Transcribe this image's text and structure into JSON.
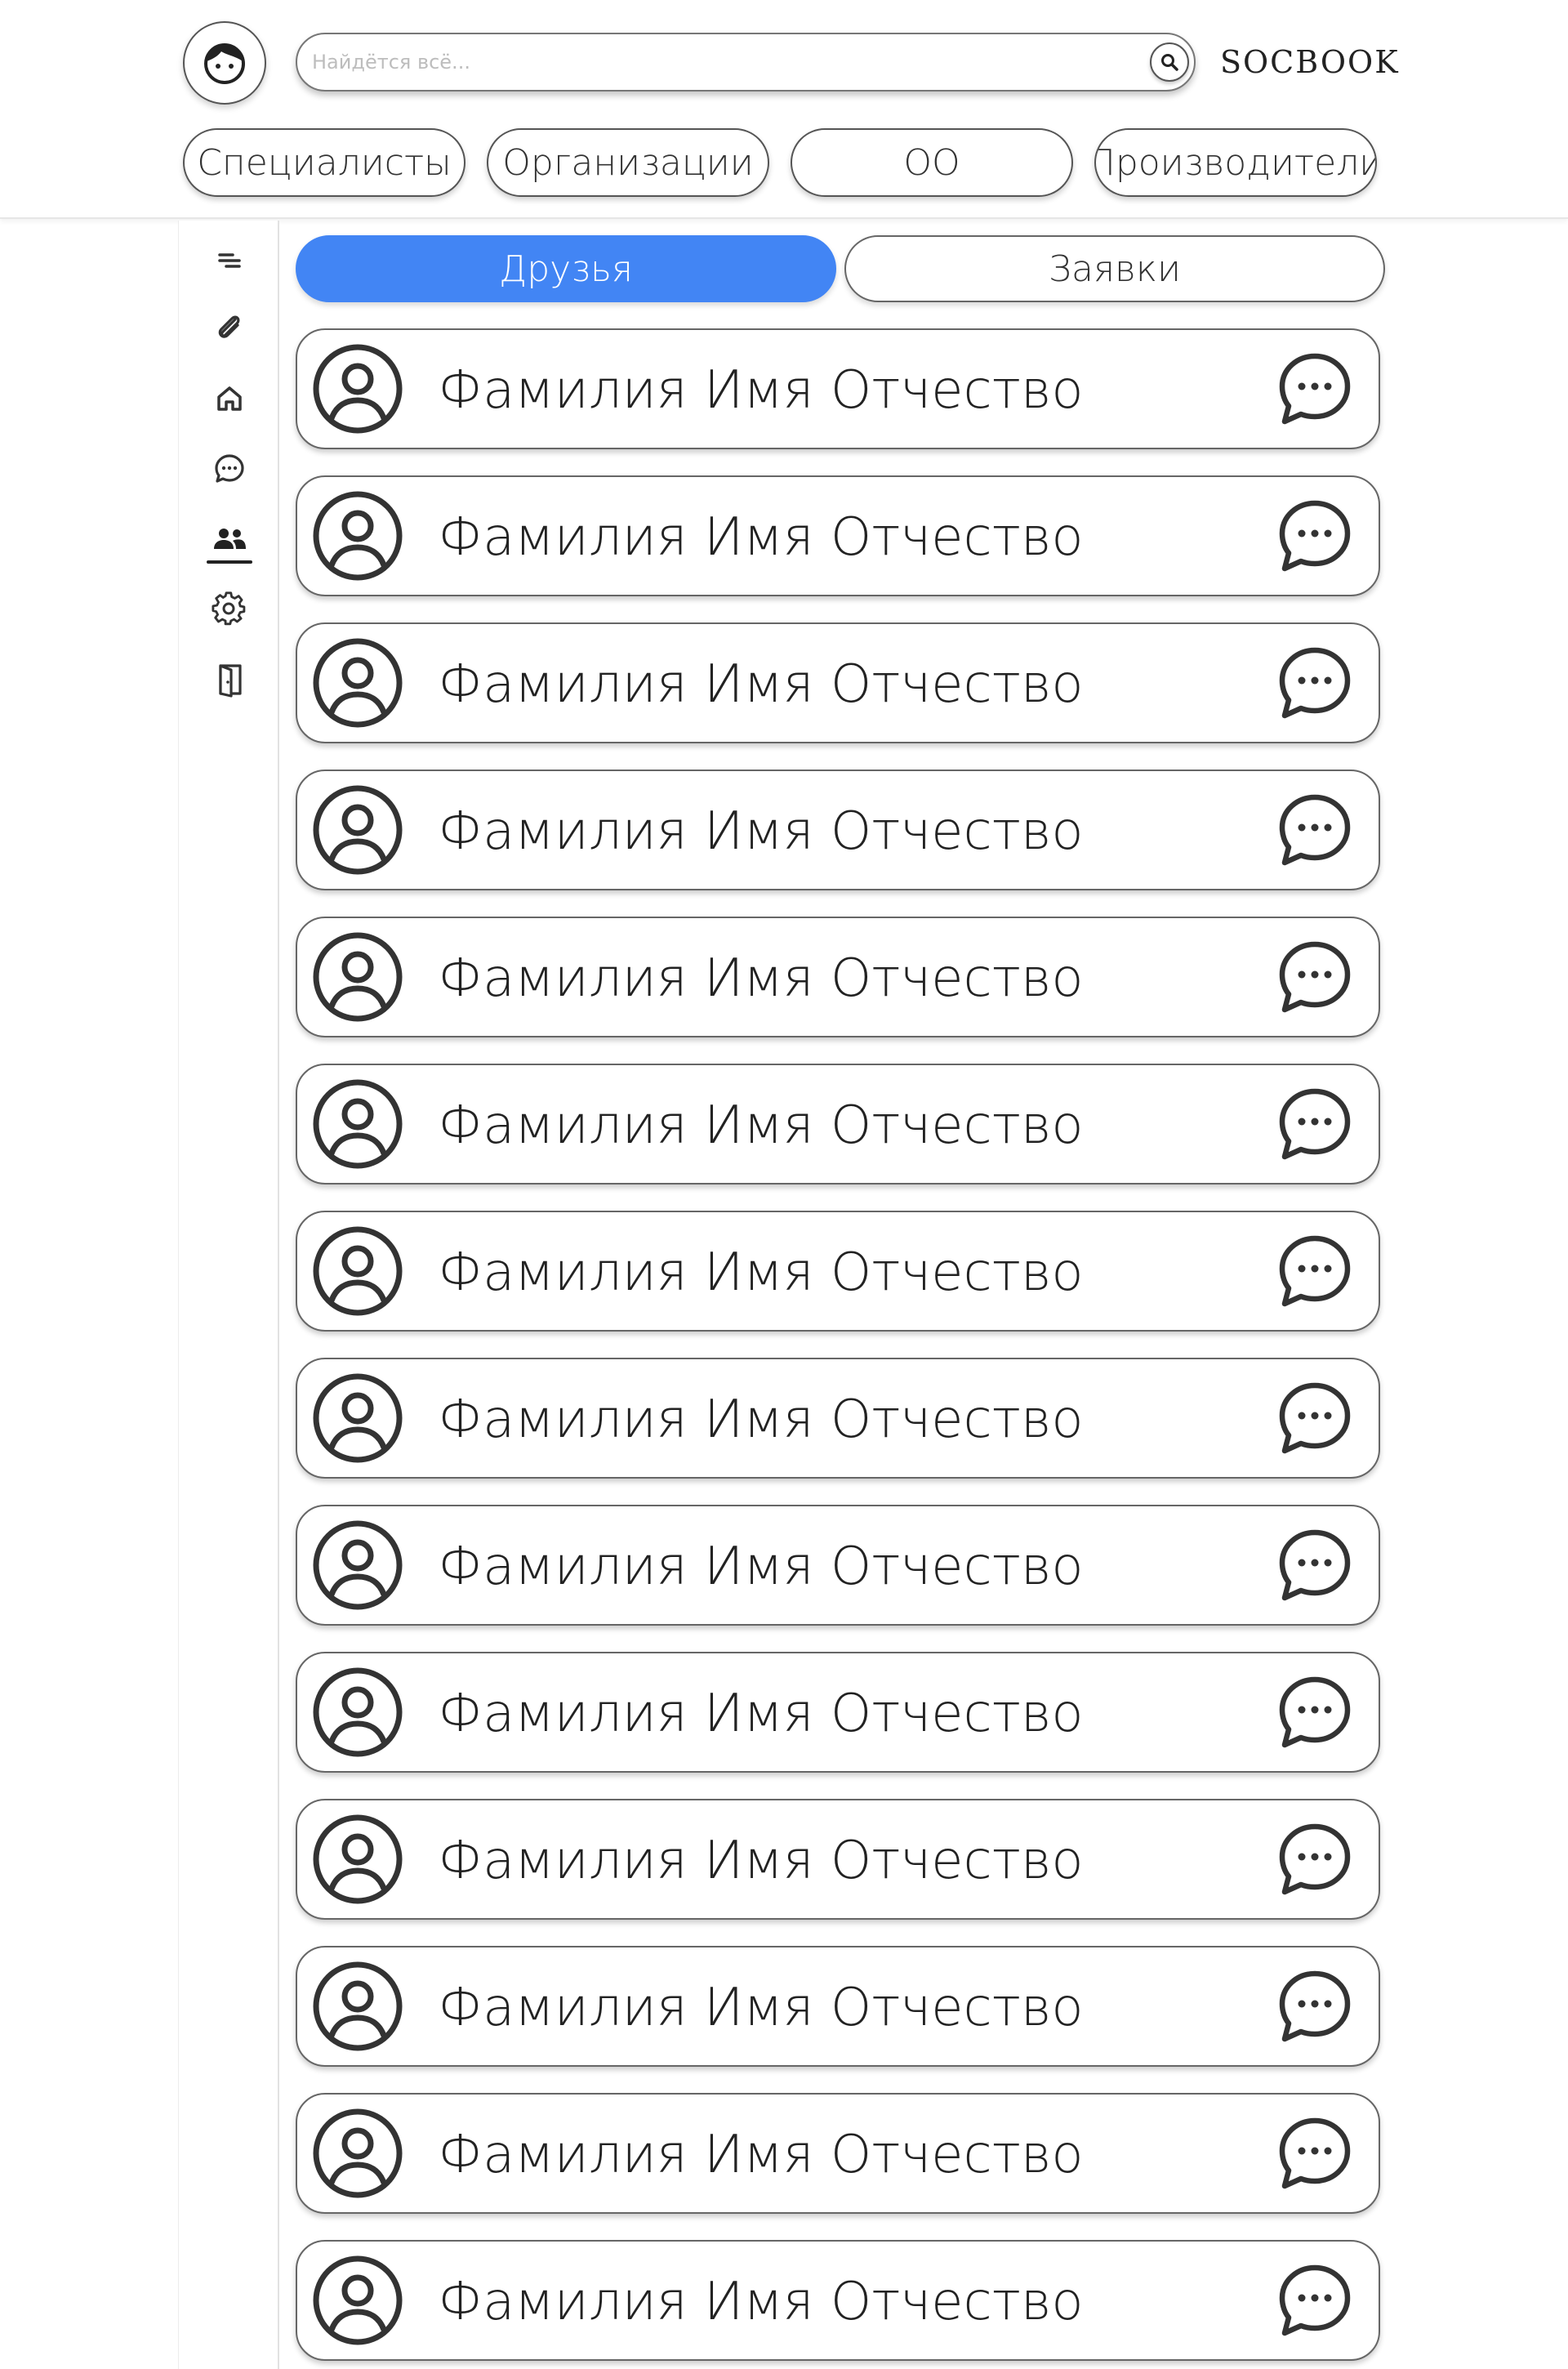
{
  "header": {
    "brand": "SOCBOOK",
    "search": {
      "placeholder": "Найдётся всё..."
    },
    "categories": [
      "Специалисты",
      "Организации",
      "ОО",
      "Производители"
    ]
  },
  "sidebar": {
    "items": [
      {
        "icon": "menu-icon"
      },
      {
        "icon": "paperclip-icon"
      },
      {
        "icon": "home-icon"
      },
      {
        "icon": "chat-icon"
      },
      {
        "icon": "friends-icon",
        "active": true
      },
      {
        "icon": "settings-icon"
      },
      {
        "icon": "logout-icon"
      }
    ]
  },
  "tabs": [
    {
      "label": "Друзья",
      "active": true
    },
    {
      "label": "Заявки",
      "active": false
    }
  ],
  "friends": [
    {
      "name": "Фамилия Имя Отчество"
    },
    {
      "name": "Фамилия Имя Отчество"
    },
    {
      "name": "Фамилия Имя Отчество"
    },
    {
      "name": "Фамилия Имя Отчество"
    },
    {
      "name": "Фамилия Имя Отчество"
    },
    {
      "name": "Фамилия Имя Отчество"
    },
    {
      "name": "Фамилия Имя Отчество"
    },
    {
      "name": "Фамилия Имя Отчество"
    },
    {
      "name": "Фамилия Имя Отчество"
    },
    {
      "name": "Фамилия Имя Отчество"
    },
    {
      "name": "Фамилия Имя Отчество"
    },
    {
      "name": "Фамилия Имя Отчество"
    },
    {
      "name": "Фамилия Имя Отчество"
    },
    {
      "name": "Фамилия Имя Отчество"
    }
  ],
  "colors": {
    "accent": "#4285f4",
    "icon": "#333333",
    "border": "#666666"
  }
}
